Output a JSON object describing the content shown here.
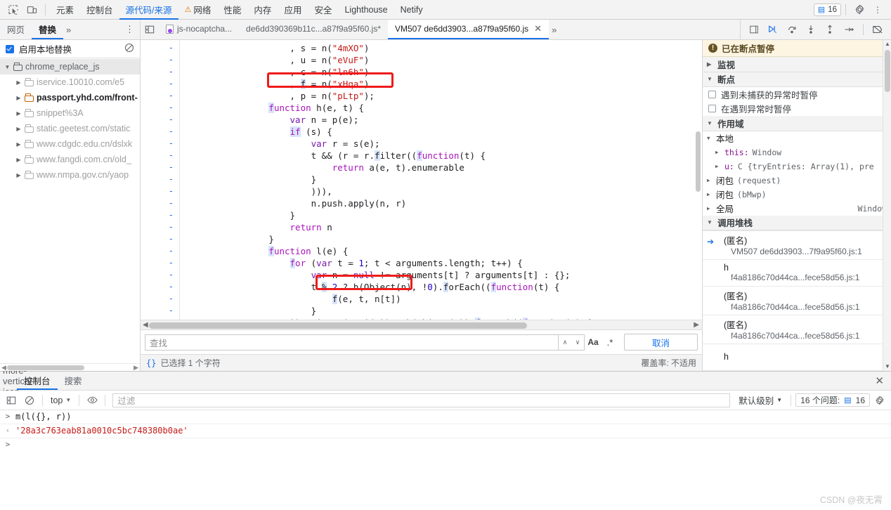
{
  "toolbar": {
    "inspect_icon": "inspect-element-icon",
    "device_icon": "device-toolbar-icon",
    "tabs": [
      {
        "label": "元素",
        "active": false,
        "warn": false
      },
      {
        "label": "控制台",
        "active": false,
        "warn": false
      },
      {
        "label": "源代码/来源",
        "active": true,
        "warn": false
      },
      {
        "label": "网络",
        "active": false,
        "warn": true
      },
      {
        "label": "性能",
        "active": false,
        "warn": false
      },
      {
        "label": "内存",
        "active": false,
        "warn": false
      },
      {
        "label": "应用",
        "active": false,
        "warn": false
      },
      {
        "label": "安全",
        "active": false,
        "warn": false
      },
      {
        "label": "Lighthouse",
        "active": false,
        "warn": false
      },
      {
        "label": "Netify",
        "active": false,
        "warn": false
      }
    ],
    "issues_count": "16",
    "settings_icon": "gear-icon",
    "more_icon": "more-vertical-icon"
  },
  "navigator": {
    "tabs": [
      {
        "label": "网页",
        "active": false
      },
      {
        "label": "替换",
        "active": true
      }
    ],
    "more_tabs": "»",
    "more_options": "⋮",
    "override_label": "启用本地替换",
    "clear_icon": "clear-overrides-icon",
    "tree": [
      {
        "label": "chrome_replace_js",
        "level": 0,
        "open": true,
        "bold": false,
        "folder": "dark"
      },
      {
        "label": "iservice.10010.com/e5",
        "level": 1,
        "open": false,
        "bold": false,
        "folder": "gray"
      },
      {
        "label": "passport.yhd.com/front-",
        "level": 1,
        "open": false,
        "bold": true,
        "folder": "orange"
      },
      {
        "label": "snippet%3A",
        "level": 1,
        "open": false,
        "bold": false,
        "folder": "gray"
      },
      {
        "label": "static.geetest.com/static",
        "level": 1,
        "open": false,
        "bold": false,
        "folder": "gray"
      },
      {
        "label": "www.cdgdc.edu.cn/dslxk",
        "level": 1,
        "open": false,
        "bold": false,
        "folder": "gray"
      },
      {
        "label": "www.fangdi.com.cn/old_",
        "level": 1,
        "open": false,
        "bold": false,
        "folder": "gray"
      },
      {
        "label": "www.nmpa.gov.cn/yaop",
        "level": 1,
        "open": false,
        "bold": false,
        "folder": "gray"
      }
    ]
  },
  "editor": {
    "panel_toggle_icon": "show-navigator-icon",
    "tabs": [
      {
        "label": "js-nocaptcha...",
        "active": false,
        "has_icon": true,
        "closable": false
      },
      {
        "label": "de6dd390369b11c...a87f9a95f60.js*",
        "active": false,
        "has_icon": false,
        "closable": false
      },
      {
        "label": "VM507 de6dd3903...a87f9a95f60.js",
        "active": true,
        "has_icon": false,
        "closable": true
      }
    ],
    "overflow_tabs": "»",
    "split_icon": "split-editor-icon",
    "debug_buttons": [
      {
        "name": "resume-script-execution",
        "glyph": "▶",
        "accent": true
      },
      {
        "name": "step-over-next-function-call",
        "glyph": "↷",
        "accent": false
      },
      {
        "name": "step-into-next-function-call",
        "glyph": "↓",
        "accent": false
      },
      {
        "name": "step-out-of-current-function",
        "glyph": "↑",
        "accent": false
      },
      {
        "name": "step",
        "glyph": "→",
        "accent": false
      },
      {
        "name": "deactivate-breakpoints",
        "glyph": "⃠",
        "accent": false
      }
    ],
    "code_lines": [
      {
        "indent": 20,
        "text": ", s = n(\"4mXO\")"
      },
      {
        "indent": 20,
        "text": ", u = n(\"eVuF\")"
      },
      {
        "indent": 20,
        "text": ", c = n(\"ln6h\")"
      },
      {
        "indent": 20,
        "text": ", f = n(\"xHqa\")"
      },
      {
        "indent": 20,
        "text": ", p = n(\"pLtp\");"
      },
      {
        "indent": 16,
        "text": "function h(e, t) {"
      },
      {
        "indent": 20,
        "text": "var n = p(e);"
      },
      {
        "indent": 20,
        "text": "if (s) {"
      },
      {
        "indent": 24,
        "text": "var r = s(e);"
      },
      {
        "indent": 24,
        "text": "t && (r = r.filter((function(t) {"
      },
      {
        "indent": 28,
        "text": "return a(e, t).enumerable"
      },
      {
        "indent": 24,
        "text": "}"
      },
      {
        "indent": 24,
        "text": "))),"
      },
      {
        "indent": 24,
        "text": "n.push.apply(n, r)"
      },
      {
        "indent": 20,
        "text": "}"
      },
      {
        "indent": 20,
        "text": "return n"
      },
      {
        "indent": 16,
        "text": "}"
      },
      {
        "indent": 16,
        "text": "function l(e) {"
      },
      {
        "indent": 20,
        "text": "for (var t = 1; t < arguments.length; t++) {"
      },
      {
        "indent": 24,
        "text": "var n = null != arguments[t] ? arguments[t] : {};"
      },
      {
        "indent": 24,
        "text": "t % 2 ? h(Object(n), !0).forEach((function(t) {"
      },
      {
        "indent": 28,
        "text": "f(e, t, n[t])"
      },
      {
        "indent": 28,
        "text": "}"
      },
      {
        "indent": 24,
        "text": ")) : i ? o(e, i(n)) : h(Object(n)).forEach((function(t) {"
      }
    ],
    "gutter_marker": "-",
    "annotations": [
      {
        "name": "highlight-box-declaration",
        "note": ", f = n(\"xHqa\")"
      },
      {
        "name": "highlight-box-call",
        "note": "f(e, t, n[t])"
      }
    ],
    "find": {
      "placeholder": "查找",
      "prev_icon": "chevron-up-icon",
      "next_icon": "chevron-down-icon",
      "match_case_label": "Aa",
      "regex_label": ".*",
      "cancel_label": "取消"
    },
    "status": {
      "format_icon": "{}",
      "selection_text": "已选择 1 个字符",
      "coverage_text": "覆盖率: 不适用"
    }
  },
  "debugger": {
    "paused_banner": "已在断点暂停",
    "watch_title": "监视",
    "breakpoints_title": "断点",
    "breakpoint_options": [
      {
        "label": "遇到未捕获的异常时暂停",
        "checked": false
      },
      {
        "label": "在遇到异常时暂停",
        "checked": false
      }
    ],
    "scope_title": "作用域",
    "scope_items": [
      {
        "indent": 0,
        "caret": "▼",
        "label": "本地",
        "mono": false,
        "value": "",
        "right": ""
      },
      {
        "indent": 1,
        "caret": "▶",
        "label": "this:",
        "mono": true,
        "value": "Window",
        "right": ""
      },
      {
        "indent": 1,
        "caret": "▶",
        "label": "u:",
        "mono": true,
        "value": "C {tryEntries: Array(1), pre",
        "right": ""
      },
      {
        "indent": 0,
        "caret": "▶",
        "label": "闭包",
        "mono": false,
        "value": "(request)",
        "right": ""
      },
      {
        "indent": 0,
        "caret": "▶",
        "label": "闭包",
        "mono": false,
        "value": "(bMwp)",
        "right": ""
      },
      {
        "indent": 0,
        "caret": "▶",
        "label": "全局",
        "mono": false,
        "value": "",
        "right": "Window"
      }
    ],
    "callstack_title": "调用堆栈",
    "callstack": [
      {
        "fn": "(匿名)",
        "loc": "VM507 de6dd3903...7f9a95f60.js:1",
        "current": true
      },
      {
        "fn": "h",
        "loc": "f4a8186c70d44ca...fece58d56.js:1",
        "current": false
      },
      {
        "fn": "(匿名)",
        "loc": "f4a8186c70d44ca...fece58d56.js:1",
        "current": false
      },
      {
        "fn": "(匿名)",
        "loc": "f4a8186c70d44ca...fece58d56.js:1",
        "current": false
      },
      {
        "fn": "h",
        "loc": "",
        "current": false
      }
    ]
  },
  "drawer": {
    "menu_icon": "more-vertical-icon",
    "tabs": [
      {
        "label": "控制台",
        "active": true
      },
      {
        "label": "搜索",
        "active": false
      }
    ],
    "close_icon": "close-icon",
    "console_toolbar": {
      "sidebar_icon": "console-sidebar-icon",
      "clear_icon": "clear-console-icon",
      "context": "top",
      "context_caret": "▼",
      "eye_icon": "live-expression-icon",
      "filter_placeholder": "过滤",
      "level_label": "默认级别",
      "level_caret": "▼",
      "problems_label": "16 个问题:",
      "problems_count": "16",
      "settings_icon": "gear-icon"
    },
    "messages": [
      {
        "marker": ">",
        "text": "m(l({}, r))",
        "kind": "input"
      },
      {
        "marker": "‹",
        "text": "'28a3c763eab81a0010c5bc748380b0ae'",
        "kind": "result"
      },
      {
        "marker": ">",
        "text": "",
        "kind": "prompt"
      }
    ]
  },
  "watermark": "CSDN @夜无霄"
}
